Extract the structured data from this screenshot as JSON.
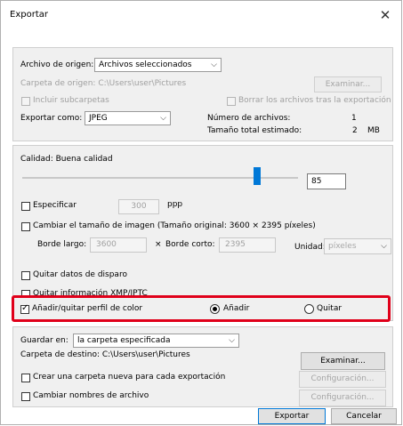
{
  "window": {
    "title": "Exportar"
  },
  "source": {
    "label": "Archivo de origen:",
    "selected": "Archivos seleccionados",
    "folder_label": "Carpeta de origen: C:\\Users\\user\\Pictures",
    "browse_label": "Examinar...",
    "include_subfolders": "Incluir subcarpetas",
    "delete_after": "Borrar los archivos tras la exportación",
    "export_as_label": "Exportar como:",
    "export_as_value": "JPEG",
    "file_count_label": "Número de archivos:",
    "file_count_value": "1",
    "total_size_label": "Tamaño total estimado:",
    "total_size_value": "2",
    "total_size_unit": "MB"
  },
  "quality": {
    "label": "Calidad: Buena calidad",
    "value": "85",
    "slider_fraction": 0.85
  },
  "resolution": {
    "specify_label": "Especificar",
    "dpi_value": "300",
    "dpi_unit": "ppp"
  },
  "resize": {
    "label": "Cambiar el tamaño de imagen (Tamaño original: 3600 × 2395 píxeles)",
    "long_edge_label": "Borde largo:",
    "long_edge_value": "3600",
    "times": "×",
    "short_edge_label": "Borde corto:",
    "short_edge_value": "2395",
    "unit_label": "Unidad:",
    "unit_value": "píxeles"
  },
  "metadata": {
    "remove_shooting_data": "Quitar datos de disparo",
    "remove_xmp": "Quitar información XMP/IPTC",
    "color_profile_label": "Añadir/quitar perfil de color",
    "add_label": "Añadir",
    "remove_label": "Quitar"
  },
  "destination": {
    "save_in_label": "Guardar en:",
    "save_in_value": "la carpeta especificada",
    "folder_label": "Carpeta de destino: C:\\Users\\user\\Pictures",
    "browse_label": "Examinar...",
    "new_folder_label": "Crear una carpeta nueva para cada exportación",
    "config1_label": "Configuración...",
    "rename_label": "Cambiar nombres de archivo",
    "config2_label": "Configuración..."
  },
  "footer": {
    "export_label": "Exportar",
    "cancel_label": "Cancelar"
  },
  "colors": {
    "highlight": "#e0001a",
    "slider_thumb": "#0078d7"
  }
}
